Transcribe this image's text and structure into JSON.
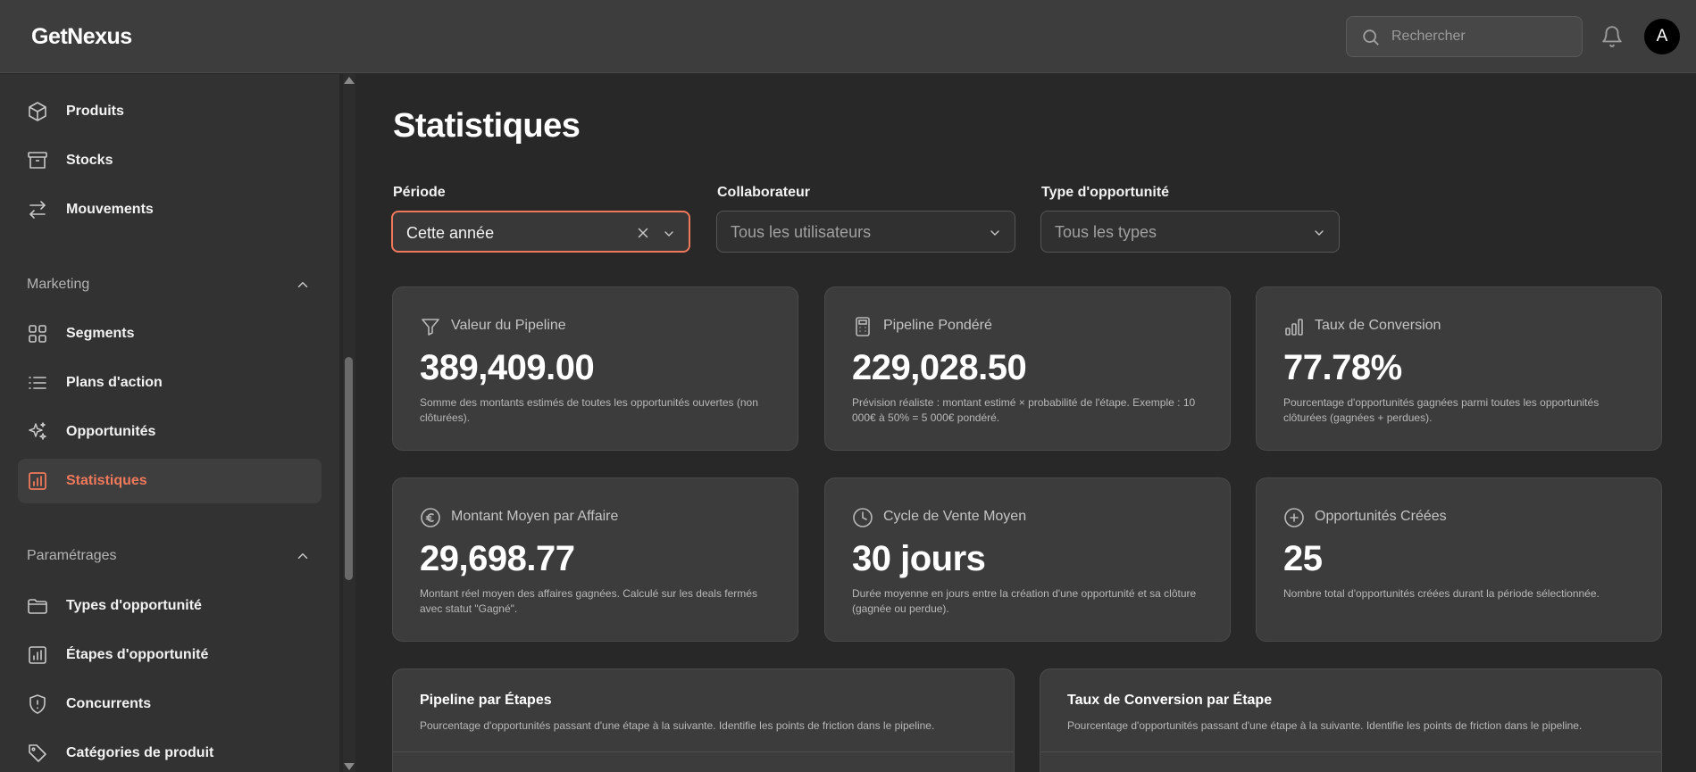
{
  "app": {
    "logo": "GetNexus"
  },
  "header": {
    "search_placeholder": "Rechercher",
    "avatar_initial": "A"
  },
  "sidebar": {
    "items_top": [
      {
        "label": "Produits",
        "icon": "cube-icon"
      },
      {
        "label": "Stocks",
        "icon": "archive-box-icon"
      },
      {
        "label": "Mouvements",
        "icon": "arrows-exchange-icon"
      }
    ],
    "marketing": {
      "title": "Marketing",
      "items": [
        {
          "label": "Segments",
          "icon": "grid-icon"
        },
        {
          "label": "Plans d'action",
          "icon": "list-icon"
        },
        {
          "label": "Opportunités",
          "icon": "sparkles-icon"
        },
        {
          "label": "Statistiques",
          "icon": "chart-bars-icon",
          "active": true
        }
      ]
    },
    "settings": {
      "title": "Paramétrages",
      "items": [
        {
          "label": "Types d'opportunité",
          "icon": "folder-icon"
        },
        {
          "label": "Étapes d'opportunité",
          "icon": "chart-bars-icon"
        },
        {
          "label": "Concurrents",
          "icon": "shield-alert-icon"
        },
        {
          "label": "Catégories de produit",
          "icon": "tag-icon"
        }
      ]
    }
  },
  "main": {
    "title": "Statistiques",
    "filters": {
      "period": {
        "label": "Période",
        "value": "Cette année"
      },
      "collaborator": {
        "label": "Collaborateur",
        "placeholder": "Tous les utilisateurs"
      },
      "type": {
        "label": "Type d'opportunité",
        "placeholder": "Tous les types"
      }
    },
    "kpis": [
      {
        "label": "Valeur du Pipeline",
        "value": "389,409.00",
        "icon": "funnel-icon",
        "desc": "Somme des montants estimés de toutes les opportunités ouvertes (non clôturées)."
      },
      {
        "label": "Pipeline Pondéré",
        "value": "229,028.50",
        "icon": "calculator-icon",
        "desc": "Prévision réaliste : montant estimé × probabilité de l'étape. Exemple : 10 000€ à 50% = 5 000€ pondéré."
      },
      {
        "label": "Taux de Conversion",
        "value": "77.78%",
        "icon": "bar-chart-icon",
        "desc": "Pourcentage d'opportunités gagnées parmi toutes les opportunités clôturées (gagnées + perdues)."
      },
      {
        "label": "Montant Moyen par Affaire",
        "value": "29,698.77",
        "icon": "euro-circle-icon",
        "desc": "Montant réel moyen des affaires gagnées. Calculé sur les deals fermés avec statut \"Gagné\"."
      },
      {
        "label": "Cycle de Vente Moyen",
        "value": "30 jours",
        "icon": "clock-icon",
        "desc": "Durée moyenne en jours entre la création d'une opportunité et sa clôture (gagnée ou perdue)."
      },
      {
        "label": "Opportunités Créées",
        "value": "25",
        "icon": "plus-circle-icon",
        "desc": "Nombre total d'opportunités créées durant la période sélectionnée."
      }
    ],
    "panels": [
      {
        "title": "Pipeline par Étapes",
        "subtitle": "Pourcentage d'opportunités passant d'une étape à la suivante. Identifie les points de friction dans le pipeline."
      },
      {
        "title": "Taux de Conversion par Étape",
        "subtitle": "Pourcentage d'opportunités passant d'une étape à la suivante. Identifie les points de friction dans le pipeline."
      }
    ]
  },
  "colors": {
    "accent": "#f0795c",
    "background": "#282828",
    "sidebar": "#323232",
    "topbar": "#3d3d3d",
    "card": "#3c3c3c"
  }
}
